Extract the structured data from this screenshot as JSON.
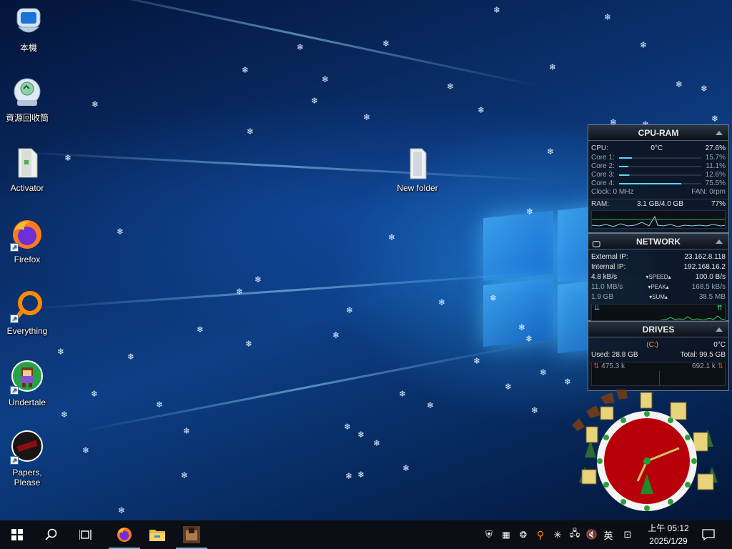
{
  "desktop": {
    "icons": [
      {
        "label": "本機",
        "icon": "computer-icon"
      },
      {
        "label": "資源回收筒",
        "icon": "recycle-bin-icon"
      },
      {
        "label": "Activator",
        "icon": "file-icon"
      },
      {
        "label": "Firefox",
        "icon": "firefox-icon",
        "shortcut": true
      },
      {
        "label": "Everything",
        "icon": "everything-search-icon",
        "shortcut": true
      },
      {
        "label": "Undertale",
        "icon": "undertale-icon",
        "shortcut": true
      },
      {
        "label": "Papers,\nPlease",
        "icon": "papers-please-icon",
        "shortcut": true
      }
    ],
    "folder": {
      "label": "New folder",
      "icon": "folder-icon"
    }
  },
  "gadgets": {
    "cpu_ram": {
      "title": "CPU-RAM",
      "cpu_label": "CPU:",
      "cpu_temp": "0°C",
      "cpu_value": "27.6%",
      "cores": [
        {
          "label": "Core 1:",
          "value": "15.7%",
          "level": 0.157
        },
        {
          "label": "Core 2:",
          "value": "11.1%",
          "level": 0.111
        },
        {
          "label": "Core 3:",
          "value": "12.6%",
          "level": 0.126
        },
        {
          "label": "Core 4:",
          "value": "75.5%",
          "level": 0.755
        }
      ],
      "clock_label": "Clock: 0 MHz",
      "fan_label": "FAN: 0rpm",
      "ram_label": "RAM:",
      "ram_usage": "3.1 GB/4.0 GB",
      "ram_percent": "77%"
    },
    "network": {
      "title": "NETWORK",
      "external_label": "External IP:",
      "external_ip": "23.162.8.118",
      "internal_label": "Internal IP:",
      "internal_ip": "192.168.16.2",
      "speed_value": "4.8 kB/s",
      "speed_tag": "SPEED",
      "speed_right": "100.0 B/s",
      "peak_value": "11.0 MB/s",
      "peak_tag": "PEAK",
      "peak_right": "168.5 kB/s",
      "sum_value": "1.9 GB",
      "sum_tag": "SUM",
      "sum_right": "38.5 MB"
    },
    "drives": {
      "title": "DRIVES",
      "drive_letter": "(C:)",
      "temp": "0°C",
      "used": "Used: 28.8 GB",
      "total": "Total: 99.5 GB",
      "read": "475.3 k",
      "write": "692.1 k"
    }
  },
  "taskbar": {
    "apps": [
      {
        "icon": "windows-start-icon"
      },
      {
        "icon": "search-icon"
      },
      {
        "icon": "task-view-icon"
      },
      {
        "icon": "firefox-icon"
      },
      {
        "icon": "file-explorer-icon"
      },
      {
        "icon": "papers-please-icon"
      }
    ],
    "ime_label": "英",
    "time": "上午 05:12",
    "date": "2025/1/29"
  },
  "colors": {
    "accent": "#76b9ed",
    "taskbar": "#0b0e14",
    "gadget_bar": "#5fd3ff",
    "clock_face": "#b8000a"
  }
}
